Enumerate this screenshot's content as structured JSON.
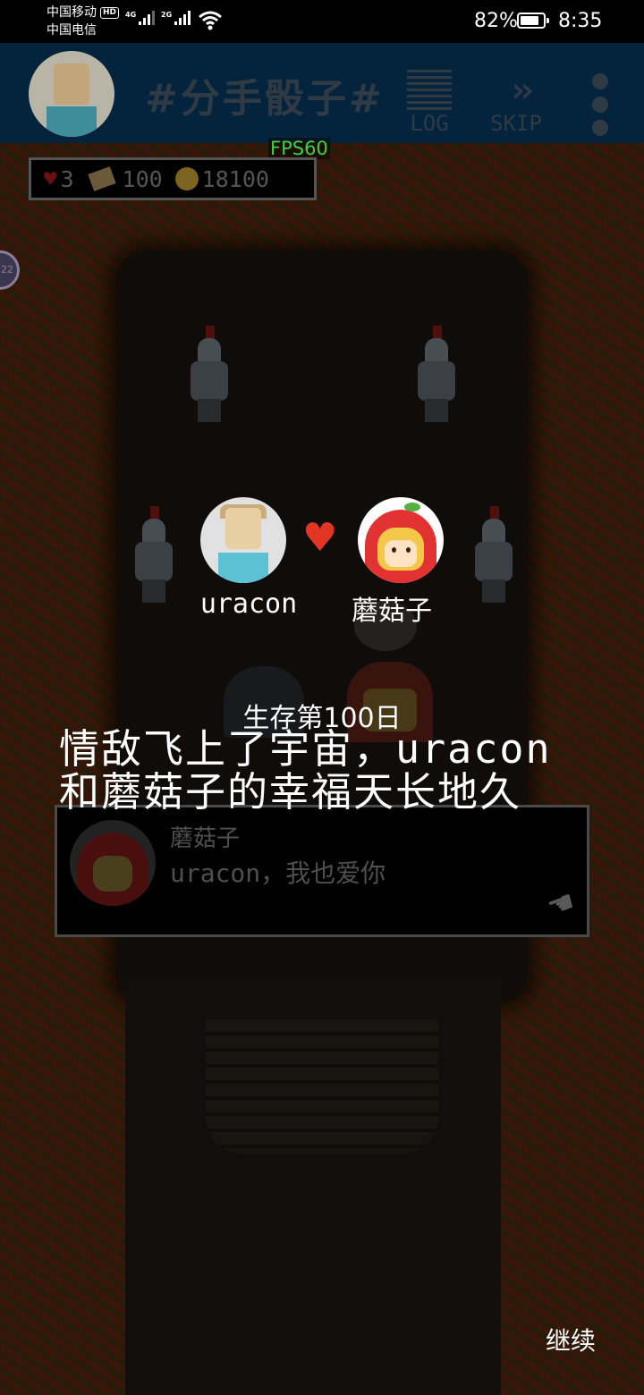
{
  "status_bar": {
    "carrier1": "中国移动",
    "carrier1_badge": "HD",
    "carrier2": "中国电信",
    "net1": "4G",
    "net2": "2G",
    "battery_pct": "82%",
    "battery_level": 0.82,
    "time": "8:35"
  },
  "header": {
    "title": "#分手骰子#",
    "log_label": "LOG",
    "skip_label": "SKIP"
  },
  "fps": "FPS60",
  "stats": {
    "hearts": "3",
    "books": "100",
    "coins": "18100"
  },
  "couple": {
    "left_name": "uracon",
    "right_name": "蘑菇子"
  },
  "story": {
    "day": "生存第100日",
    "ending": "情敌飞上了宇宙，uracon和蘑菇子的幸福天长地久"
  },
  "dialog": {
    "speaker": "蘑菇子",
    "text": "uracon，我也爱你"
  },
  "continue_label": "继续",
  "colors": {
    "header_bg": "#04243d",
    "fps_green": "#3ed33e",
    "heart_red": "#e23624"
  }
}
